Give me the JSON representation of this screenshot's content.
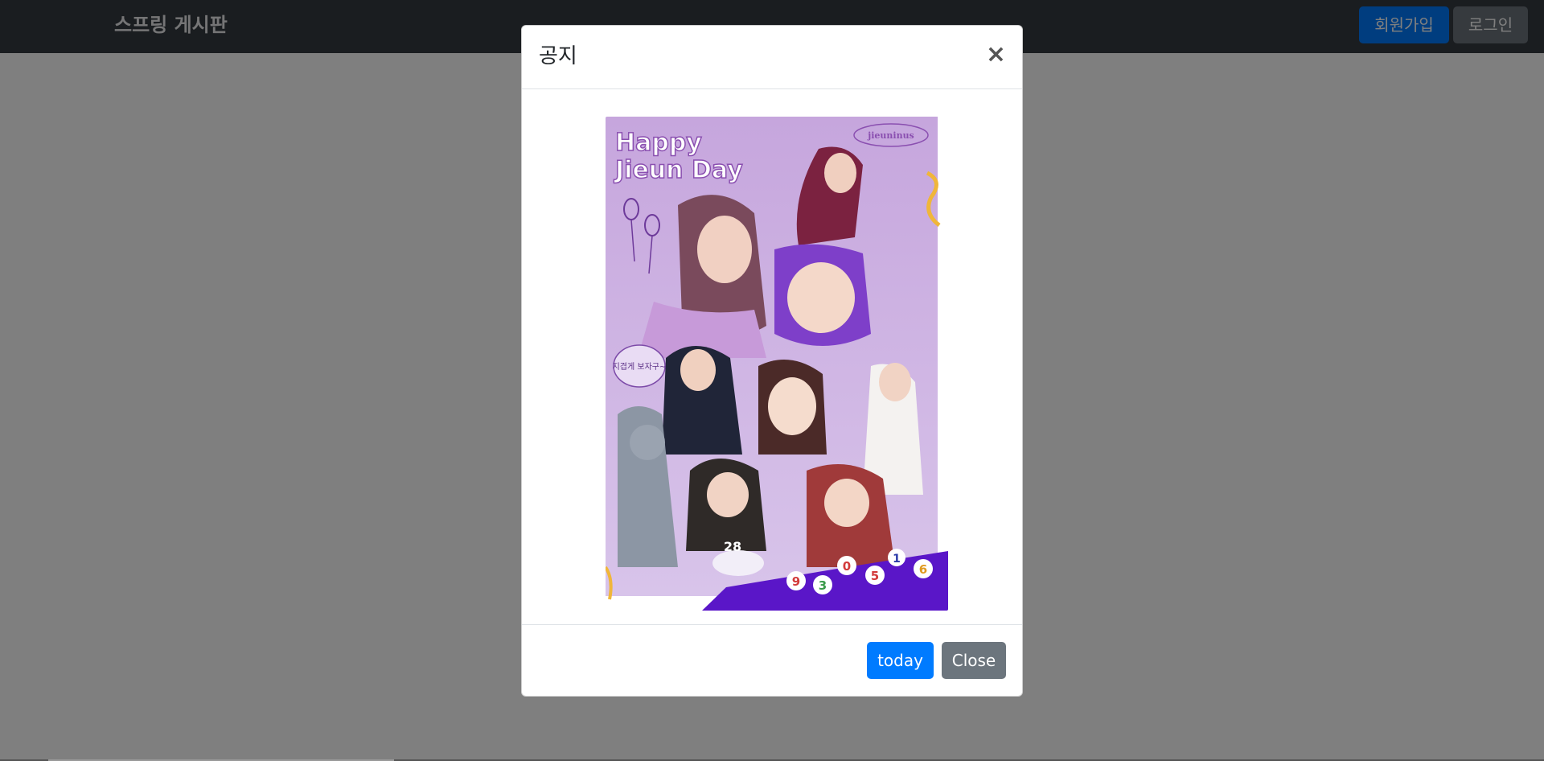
{
  "navbar": {
    "brand": "스프링 게시판",
    "signup_label": "회원가입",
    "login_label": "로그인"
  },
  "modal": {
    "title": "공지",
    "close_symbol": "×",
    "poster": {
      "heading_line1": "Happy",
      "heading_line2": "Jieun Day",
      "tag": "jieuninus",
      "speech": "지겹게 보자구~",
      "cake_number": "28",
      "birth_digits": [
        "9",
        "3",
        "0",
        "5",
        "1",
        "6"
      ]
    },
    "today_label": "today",
    "close_label": "Close"
  },
  "colors": {
    "navbar_bg": "#343a40",
    "primary": "#007bff",
    "secondary": "#6c757d",
    "poster_bg": "#c9aee0",
    "poster_purple": "#5a16c8"
  }
}
